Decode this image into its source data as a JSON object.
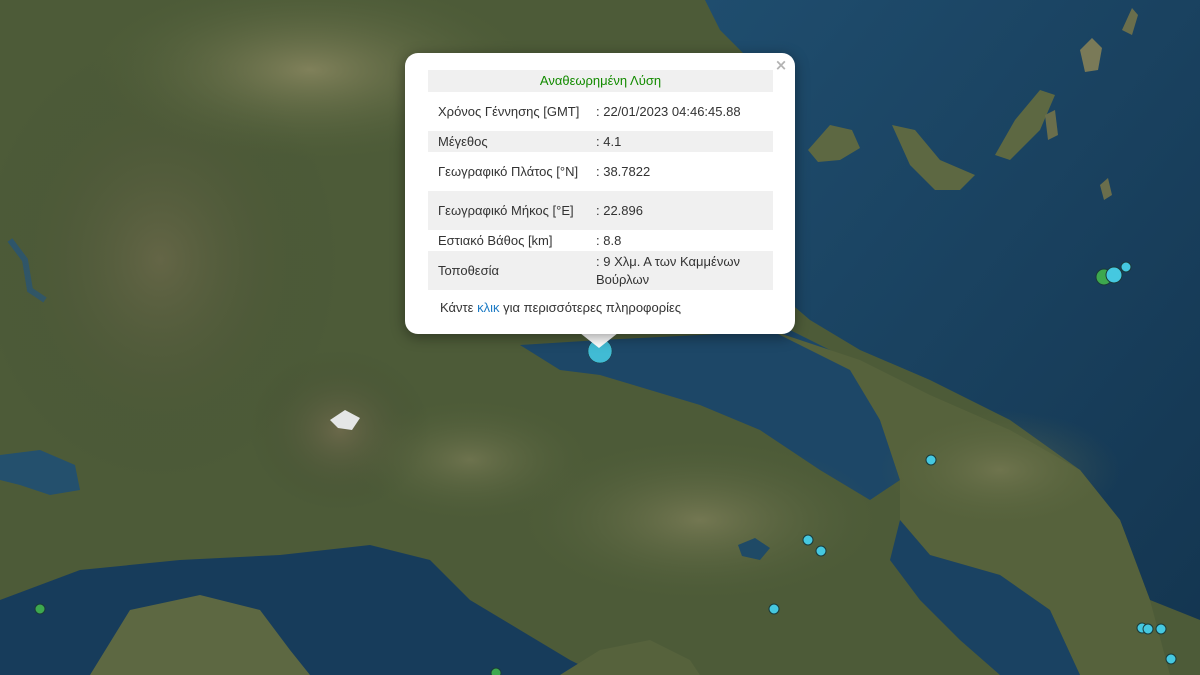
{
  "map": {
    "colors": {
      "sea_deep": "#143651",
      "sea": "#1d4767",
      "land": "#4b5a37",
      "land_light": "#8c8a62",
      "mountain": "#3c4a2e",
      "quake_cyan": "#45c8e0",
      "quake_green": "#3da84e"
    },
    "events": [
      {
        "id": "selected",
        "lat": 38.7822,
        "lon": 22.896,
        "color": "#45c8e0",
        "selected": true
      },
      {
        "id": "e1",
        "color": "#3da84e"
      },
      {
        "id": "e2",
        "color": "#45c8e0"
      },
      {
        "id": "e3",
        "color": "#45c8e0"
      },
      {
        "id": "e4",
        "color": "#45c8e0"
      },
      {
        "id": "e5",
        "color": "#45c8e0"
      },
      {
        "id": "e6",
        "color": "#45c8e0"
      },
      {
        "id": "e7",
        "color": "#45c8e0"
      },
      {
        "id": "e8",
        "color": "#45c8e0"
      },
      {
        "id": "e9",
        "color": "#45c8e0"
      },
      {
        "id": "e10",
        "color": "#45c8e0"
      },
      {
        "id": "e11",
        "color": "#45c8e0"
      },
      {
        "id": "e12",
        "color": "#3da84e"
      },
      {
        "id": "e13",
        "color": "#3da84e"
      }
    ]
  },
  "popup": {
    "close_icon": "×",
    "title": "Αναθεωρημένη Λύση",
    "rows": [
      {
        "label": "Χρόνος Γέννησης [GMT]",
        "value": ": 22/01/2023 04:46:45.88"
      },
      {
        "label": "Μέγεθος",
        "value": ": 4.1"
      },
      {
        "label": "Γεωγραφικό Πλάτος [°N]",
        "value": ": 38.7822"
      },
      {
        "label": "Γεωγραφικό Μήκος [°E]",
        "value": ": 22.896"
      },
      {
        "label": "Εστιακό Βάθος [km]",
        "value": ": 8.8"
      },
      {
        "label": "Τοποθεσία",
        "value": ": 9 Χλμ. Α των Καμμένων Βούρλων"
      }
    ],
    "more_prefix": "Κάντε ",
    "more_link": "κλικ",
    "more_suffix": " για περισσότερες πληροφορίες"
  }
}
